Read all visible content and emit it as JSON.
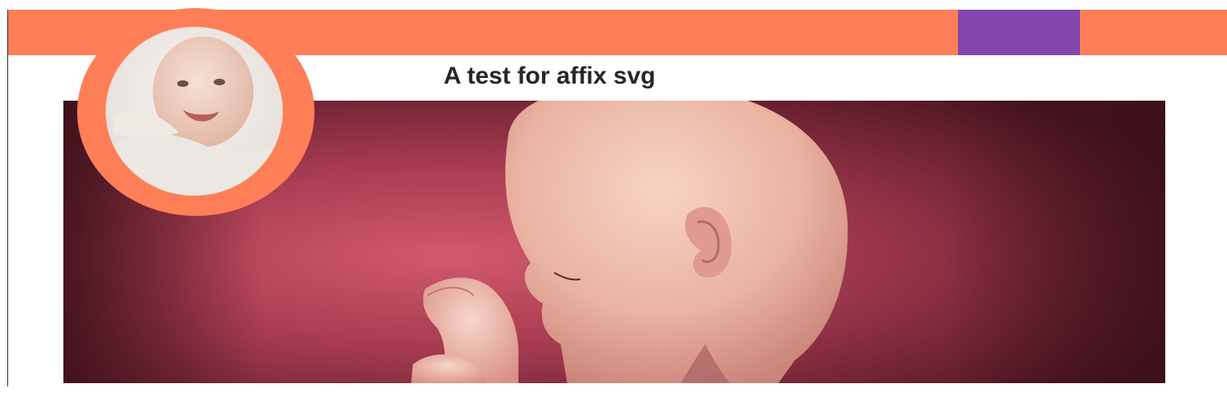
{
  "page": {
    "title": "A test for affix svg"
  },
  "colors": {
    "accent": "#fe7f57",
    "secondary": "#8246ad",
    "hero_bg": "#8e2f41",
    "text": "#262626"
  },
  "icons": {
    "avatar": "baby-avatar-photo",
    "hero": "fetus-illustration"
  }
}
